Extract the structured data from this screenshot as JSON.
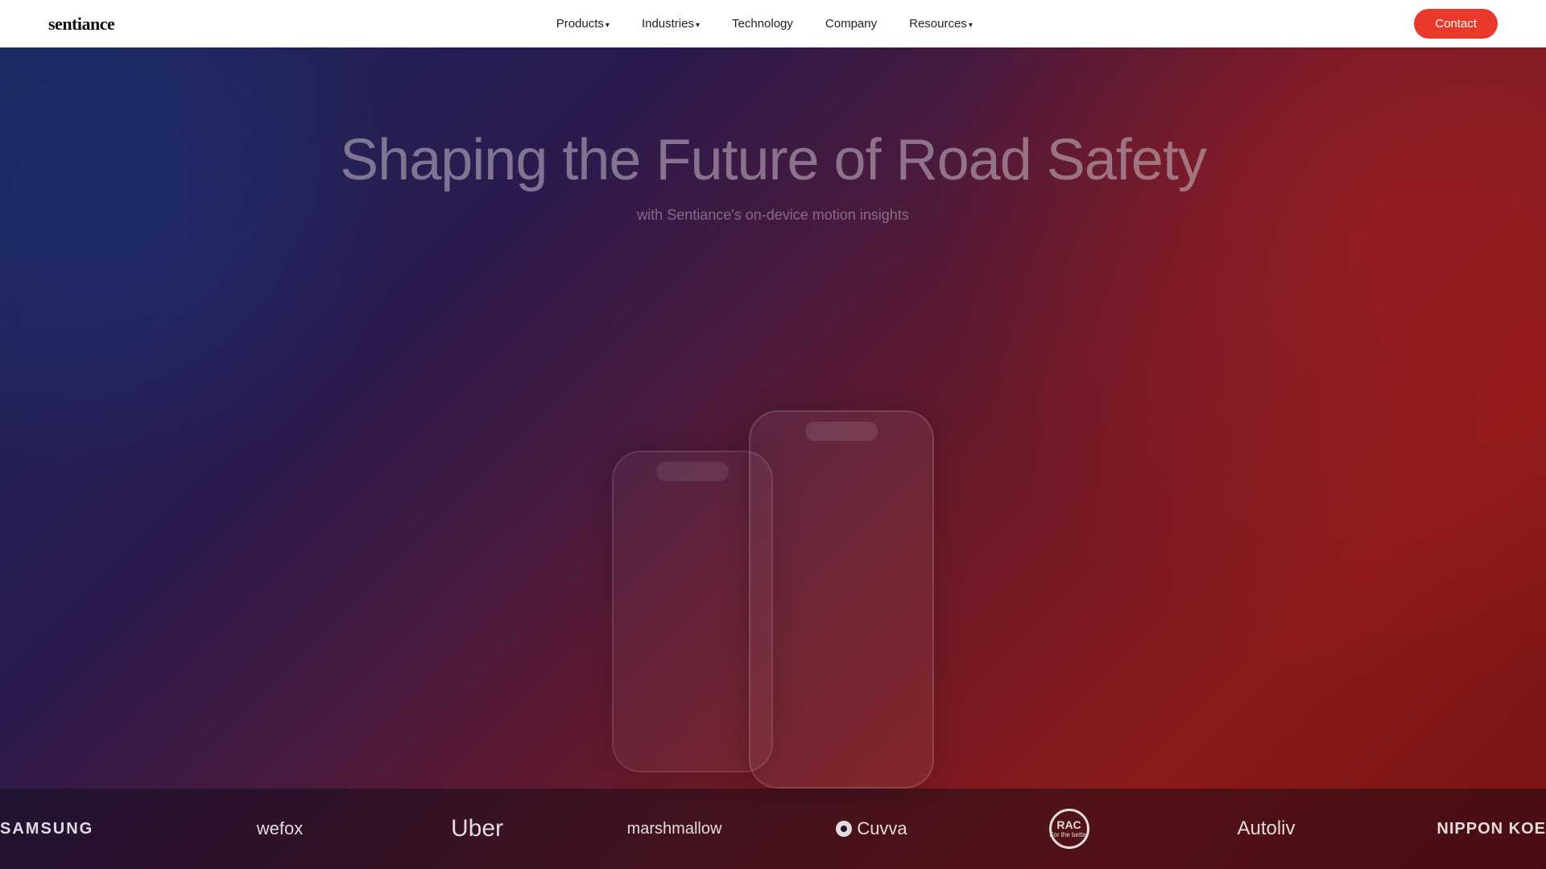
{
  "nav": {
    "logo": "sentiance",
    "links": [
      {
        "label": "Products",
        "has_caret": true
      },
      {
        "label": "Industries",
        "has_caret": true
      },
      {
        "label": "Technology",
        "has_caret": false
      },
      {
        "label": "Company",
        "has_caret": false
      },
      {
        "label": "Resources",
        "has_caret": true
      }
    ],
    "contact_label": "Contact"
  },
  "hero": {
    "title": "Shaping the Future of Road Safety",
    "subtitle": "with Sentiance's on-device motion insights"
  },
  "logos": [
    {
      "id": "samsung",
      "text": "SAMSUNG",
      "class": "samsung samsung-partial"
    },
    {
      "id": "wefox",
      "text": "wefox",
      "class": "wefox"
    },
    {
      "id": "uber",
      "text": "Uber",
      "class": "uber"
    },
    {
      "id": "marshmallow",
      "text": "marshmallow",
      "class": "marshmallow"
    },
    {
      "id": "cuvva",
      "text": "Cuvva",
      "class": "cuvva",
      "has_dot": true
    },
    {
      "id": "rac",
      "text": "RAC",
      "class": "rac",
      "sub": "For the better",
      "is_badge": true
    },
    {
      "id": "autoliv",
      "text": "Autoliv",
      "class": "autoliv"
    },
    {
      "id": "nippon",
      "text": "NIPPON KOE",
      "class": "nippon nippon-partial"
    }
  ]
}
